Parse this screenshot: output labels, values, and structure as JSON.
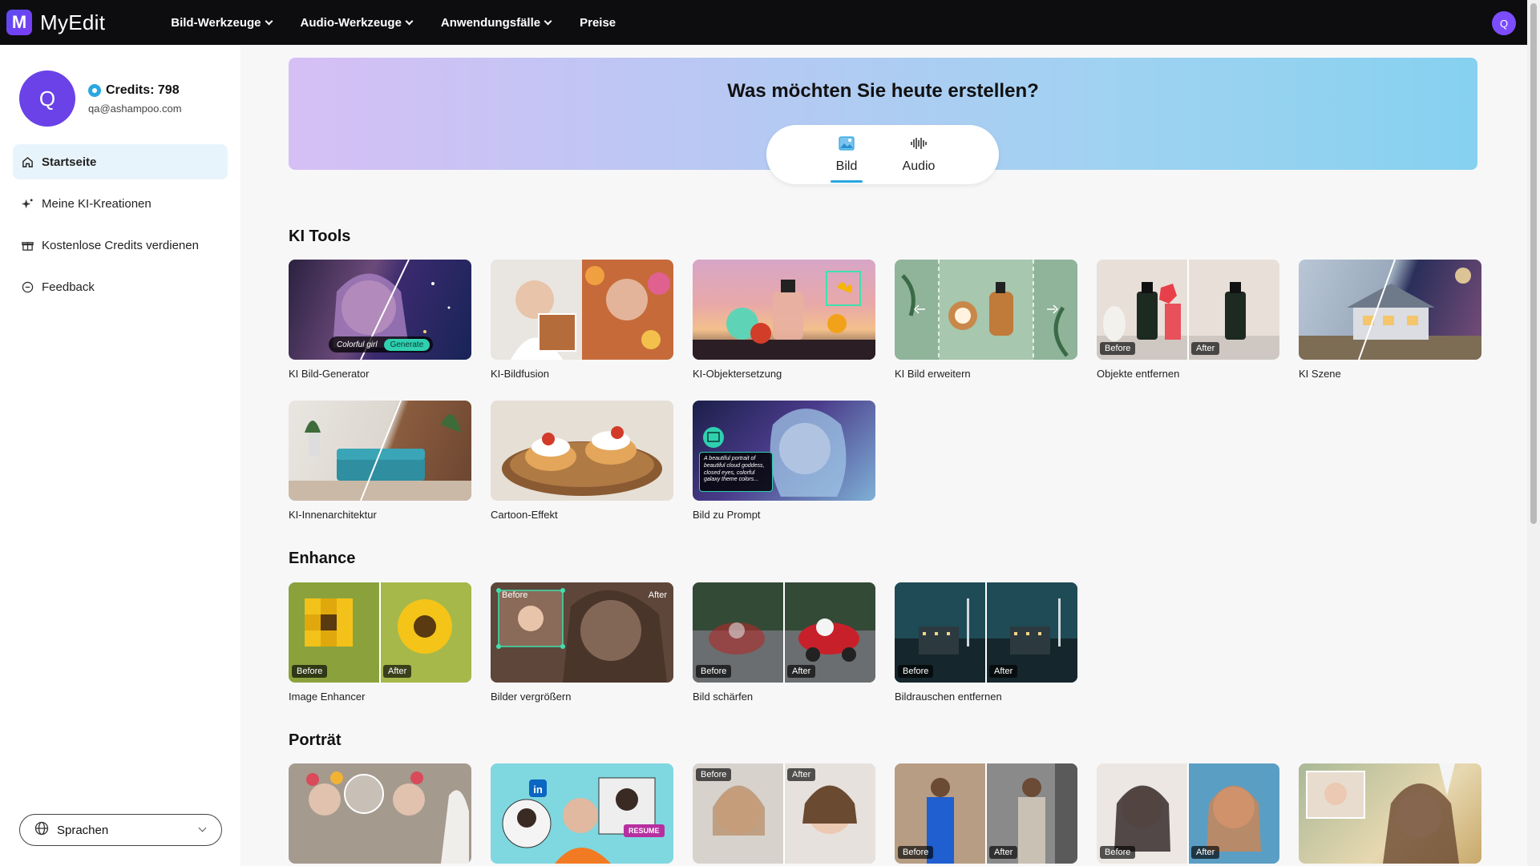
{
  "app": {
    "logo_letter": "M",
    "name": "MyEdit"
  },
  "nav": [
    {
      "label": "Bild-Werkzeuge",
      "has_dropdown": true
    },
    {
      "label": "Audio-Werkzeuge",
      "has_dropdown": true
    },
    {
      "label": "Anwendungsfälle",
      "has_dropdown": true
    },
    {
      "label": "Preise",
      "has_dropdown": false
    }
  ],
  "user": {
    "initial": "Q",
    "credits_label": "Credits: 798",
    "email": "qa@ashampoo.com"
  },
  "sidebar": {
    "items": [
      {
        "label": "Startseite",
        "icon": "home-icon",
        "active": true
      },
      {
        "label": "Meine KI-Kreationen",
        "icon": "sparkle-icon",
        "active": false
      },
      {
        "label": "Kostenlose Credits verdienen",
        "icon": "gift-icon",
        "active": false
      },
      {
        "label": "Feedback",
        "icon": "feedback-icon",
        "active": false
      }
    ],
    "language_label": "Sprachen"
  },
  "hero": {
    "title": "Was möchten Sie heute erstellen?",
    "tabs": [
      {
        "label": "Bild",
        "icon": "image-icon",
        "active": true
      },
      {
        "label": "Audio",
        "icon": "audio-wave-icon",
        "active": false
      }
    ]
  },
  "sections": [
    {
      "title": "KI Tools",
      "cards": [
        {
          "label": "KI Bild-Generator",
          "thumb_text_1": "Colorful girl",
          "thumb_text_2": "Generate"
        },
        {
          "label": "KI-Bildfusion"
        },
        {
          "label": "KI-Objektersetzung"
        },
        {
          "label": "KI Bild erweitern"
        },
        {
          "label": "Objekte entfernen",
          "before": "Before",
          "after": "After"
        },
        {
          "label": "KI Szene"
        },
        {
          "label": "KI-Innenarchitektur"
        },
        {
          "label": "Cartoon-Effekt"
        },
        {
          "label": "Bild zu Prompt",
          "thumb_text_1": "A beautiful portrait of beautiful cloud goddess, closed eyes, colorful galaxy theme colors..."
        }
      ]
    },
    {
      "title": "Enhance",
      "cards": [
        {
          "label": "Image Enhancer",
          "before": "Before",
          "after": "After"
        },
        {
          "label": "Bilder vergrößern",
          "before": "Before",
          "after": "After"
        },
        {
          "label": "Bild schärfen",
          "before": "Before",
          "after": "After"
        },
        {
          "label": "Bildrauschen entfernen",
          "before": "Before",
          "after": "After"
        }
      ]
    },
    {
      "title": "Porträt",
      "cards": [
        {
          "label": ""
        },
        {
          "label": "",
          "thumb_text_1": "RESUME"
        },
        {
          "label": "",
          "before": "Before",
          "after": "After"
        },
        {
          "label": "",
          "before": "Before",
          "after": "After"
        },
        {
          "label": "",
          "before": "Before",
          "after": "After"
        },
        {
          "label": ""
        }
      ]
    }
  ]
}
